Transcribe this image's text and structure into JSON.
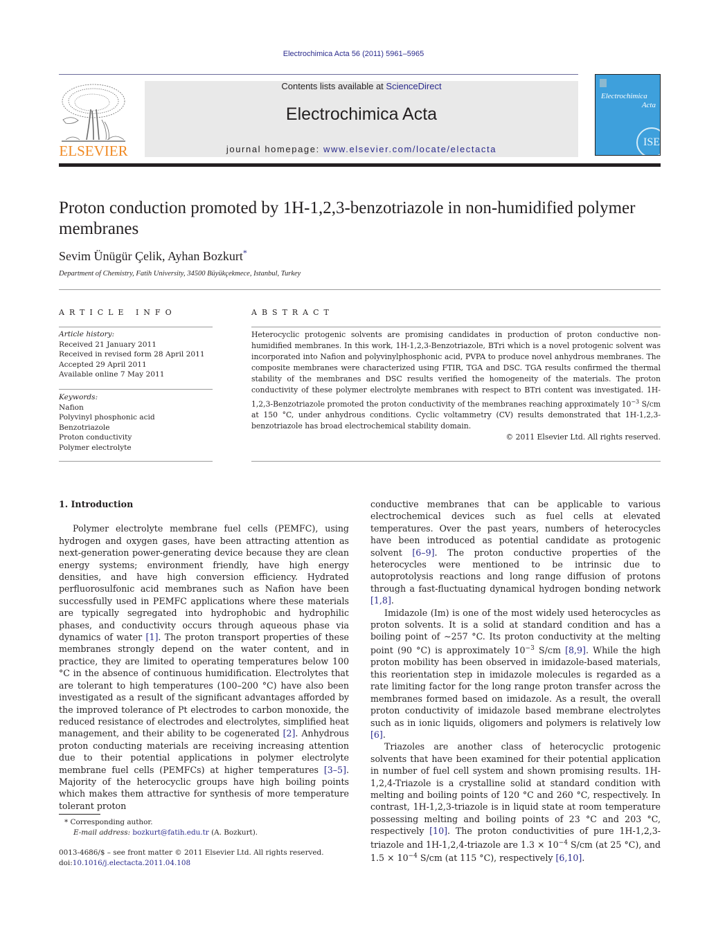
{
  "header": {
    "running_head": "Electrochimica Acta 56 (2011) 5961–5965",
    "publisher_logo_text": "ELSEVIER",
    "contents_prefix": "Contents lists available at ",
    "contents_link": "ScienceDirect",
    "journal_title": "Electrochimica Acta",
    "homepage_prefix": "journal homepage: ",
    "homepage_link": "www.elsevier.com/locate/electacta",
    "cover_title_line1": "Electrochimica",
    "cover_title_line2": "Acta",
    "cover_seal_text": "ISE"
  },
  "article": {
    "title": "Proton conduction promoted by 1H-1,2,3-benzotriazole in non-humidified polymer membranes",
    "authors": "Sevim Ünügür Çelik, Ayhan Bozkurt",
    "author_marker": "*",
    "affiliation": "Department of Chemistry, Fatih University, 34500 Büyükçekmece, Istanbul, Turkey"
  },
  "article_info": {
    "heading": "ARTICLE INFO",
    "history_label": "Article history:",
    "history": [
      "Received 21 January 2011",
      "Received in revised form 28 April 2011",
      "Accepted 29 April 2011",
      "Available online 7 May 2011"
    ],
    "keywords_label": "Keywords:",
    "keywords": [
      "Nafion",
      "Polyvinyl phosphonic acid",
      "Benzotriazole",
      "Proton conductivity",
      "Polymer electrolyte"
    ]
  },
  "abstract": {
    "heading": "ABSTRACT",
    "text_part1": "Heterocyclic protogenic solvents are promising candidates in production of proton conductive non-humidified membranes. In this work, 1H-1,2,3-Benzotriazole, BTri which is a novel protogenic solvent was incorporated into Nafion and polyvinylphosphonic acid, PVPA to produce novel anhydrous membranes. The composite membranes were characterized using FTIR, TGA and DSC. TGA results confirmed the thermal stability of the membranes and DSC results verified the homogeneity of the materials. The proton conductivity of these polymer electrolyte membranes with respect to BTri content was investigated. 1H-1,2,3-Benzotriazole promoted the proton conductivity of the membranes reaching approximately 10",
    "exponent": "−3",
    "text_part2": " S/cm at 150 °C, under anhydrous conditions. Cyclic voltammetry (CV) results demonstrated that 1H-1,2,3-benzotriazole has broad electrochemical stability domain.",
    "copyright": "© 2011 Elsevier Ltd. All rights reserved."
  },
  "body": {
    "section_heading": "1.  Introduction",
    "left_p1": [
      {
        "t": "Polymer electrolyte membrane fuel cells (PEMFC), using hydrogen and oxygen gases, have been attracting attention as next-generation power-generating device because they are clean energy systems; environment friendly, have high energy densities, and have high conversion efficiency. Hydrated perfluorosulfonic acid membranes such as Nafion have been successfully used in PEMFC applications where these materials are typically segregated into hydrophobic and hydrophilic phases, and conductivity occurs through aqueous phase via dynamics of water "
      },
      {
        "ref": "[1]"
      },
      {
        "t": ". The proton transport properties of these membranes strongly depend on the water content, and in practice, they are limited to operating temperatures below 100 °C in the absence of continuous humidification. Electrolytes that are tolerant to high temperatures (100–200 °C) have also been investigated as a result of the significant advantages afforded by the improved tolerance of Pt electrodes to carbon monoxide, the reduced resistance of electrodes and electrolytes, simplified heat management, and their ability to be cogenerated "
      },
      {
        "ref": "[2]"
      },
      {
        "t": ". Anhydrous proton conducting materials are receiving increasing attention due to their potential applications in polymer electrolyte membrane fuel cells (PEMFCs) at higher temperatures "
      },
      {
        "ref": "[3–5]"
      },
      {
        "t": ". Majority of the heterocyclic groups have high boiling points which makes them attractive for synthesis of more temperature tolerant proton"
      }
    ],
    "right_p1": [
      {
        "t": "conductive membranes that can be applicable to various electrochemical devices such as fuel cells at elevated temperatures. Over the past years, numbers of heterocycles have been introduced as potential candidate as protogenic solvent "
      },
      {
        "ref": "[6–9]"
      },
      {
        "t": ". The proton conductive properties of the heterocycles were mentioned to be intrinsic due to autoprotolysis reactions and long range diffusion of protons through a fast-fluctuating dynamical hydrogen bonding network "
      },
      {
        "ref": "[1,8]"
      },
      {
        "t": "."
      }
    ],
    "right_p2": [
      {
        "t": "Imidazole (Im) is one of the most widely used heterocycles as proton solvents. It is a solid at standard condition and has a boiling point of ∼257 °C. Its proton conductivity at the melting point (90 °C) is approximately 10"
      },
      {
        "sup": "−3"
      },
      {
        "t": " S/cm "
      },
      {
        "ref": "[8,9]"
      },
      {
        "t": ". While the high proton mobility has been observed in imidazole-based materials, this reorientation step in imidazole molecules is regarded as a rate limiting factor for the long range proton transfer across the membranes formed based on imidazole. As a result, the overall proton conductivity of imidazole based membrane electrolytes such as in ionic liquids, oligomers and polymers is relatively low "
      },
      {
        "ref": "[6]"
      },
      {
        "t": "."
      }
    ],
    "right_p3": [
      {
        "t": "Triazoles are another class of heterocyclic protogenic solvents that have been examined for their potential application in number of fuel cell system and shown promising results. 1H-1,2,4-Triazole is a crystalline solid at standard condition with melting and boiling points of 120 °C and 260 °C, respectively. In contrast, 1H-1,2,3-triazole is in liquid state at room temperature possessing melting and boiling points of 23 °C and 203 °C, respectively "
      },
      {
        "ref": "[10]"
      },
      {
        "t": ". The proton conductivities of pure 1H-1,2,3-triazole and 1H-1,2,4-triazole are 1.3 × 10"
      },
      {
        "sup": "−4"
      },
      {
        "t": " S/cm (at 25 °C), and 1.5 × 10"
      },
      {
        "sup": "−4"
      },
      {
        "t": " S/cm (at 115 °C), respectively "
      },
      {
        "ref": "[6,10]"
      },
      {
        "t": "."
      }
    ]
  },
  "footnotes": {
    "marker": "*",
    "corresponding": "Corresponding author.",
    "email_label": "E-mail address: ",
    "email": "bozkurt@fatih.edu.tr",
    "email_suffix": " (A. Bozkurt).",
    "issn_line": "0013-4686/$ – see front matter © 2011 Elsevier Ltd. All rights reserved.",
    "doi_prefix": "doi:",
    "doi": "10.1016/j.electacta.2011.04.108"
  },
  "colors": {
    "link": "#2a2a8c",
    "elsevier_orange": "#f08a24",
    "cover_blue": "#3ea0dc",
    "banner_gray": "#e9e9e9"
  }
}
